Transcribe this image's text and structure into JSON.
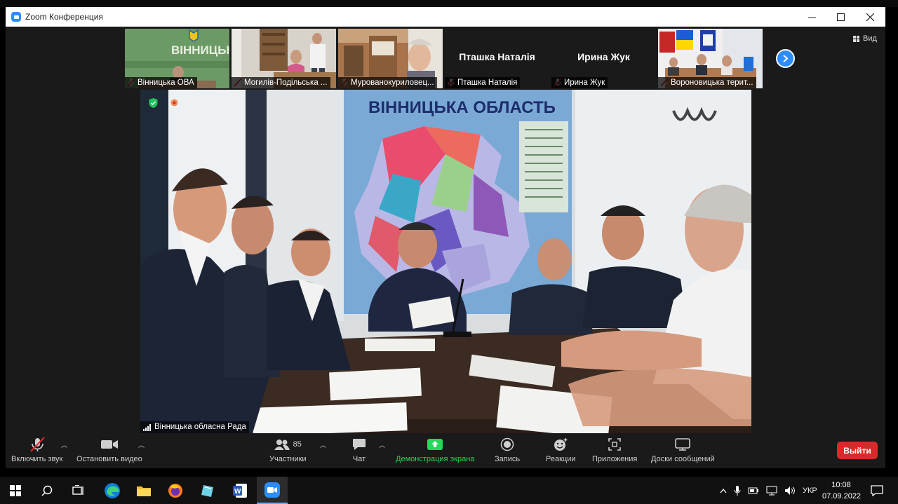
{
  "window": {
    "title": "Zoom Конференция",
    "controls": [
      "minimize-icon",
      "maximize-icon",
      "close-icon"
    ]
  },
  "gallery": {
    "participants": [
      {
        "name": "Вінницька ОВА",
        "muted": true,
        "video": true,
        "label_on_video": "ВІННИЦЬКА"
      },
      {
        "name": "Могилів-Подільська ...",
        "muted": true,
        "video": true
      },
      {
        "name": "Мурованокуриловец...",
        "muted": true,
        "video": true
      },
      {
        "name": "Пташка Наталія",
        "muted": true,
        "video": false
      },
      {
        "name": "Ирина Жук",
        "muted": true,
        "video": false
      },
      {
        "name": "Вороновицька терит...",
        "muted": true,
        "video": true
      }
    ],
    "next_icon": "chevron-right-icon",
    "view_label": "Вид"
  },
  "speaker": {
    "name": "Вінницька обласна Рада",
    "wall_map_title": "ВІННИЦЬКА ОБЛАСТЬ",
    "secure_icon": "shield-check-icon"
  },
  "toolbar": {
    "mute_label": "Включить звук",
    "video_label": "Остановить видео",
    "participants_label": "Участники",
    "participants_count": "85",
    "chat_label": "Чат",
    "share_label": "Демонстрация экрана",
    "record_label": "Запись",
    "reactions_label": "Реакции",
    "apps_label": "Приложения",
    "whiteboards_label": "Доски сообщений",
    "leave_label": "Выйти"
  },
  "taskbar": {
    "lang": "УКР",
    "time": "10:08",
    "date": "07.09.2022"
  },
  "colors": {
    "zoom_blue": "#2d8cff",
    "share_green": "#23d959",
    "leave_red": "#d82a2a",
    "meeting_bg": "#1a1a1a"
  }
}
